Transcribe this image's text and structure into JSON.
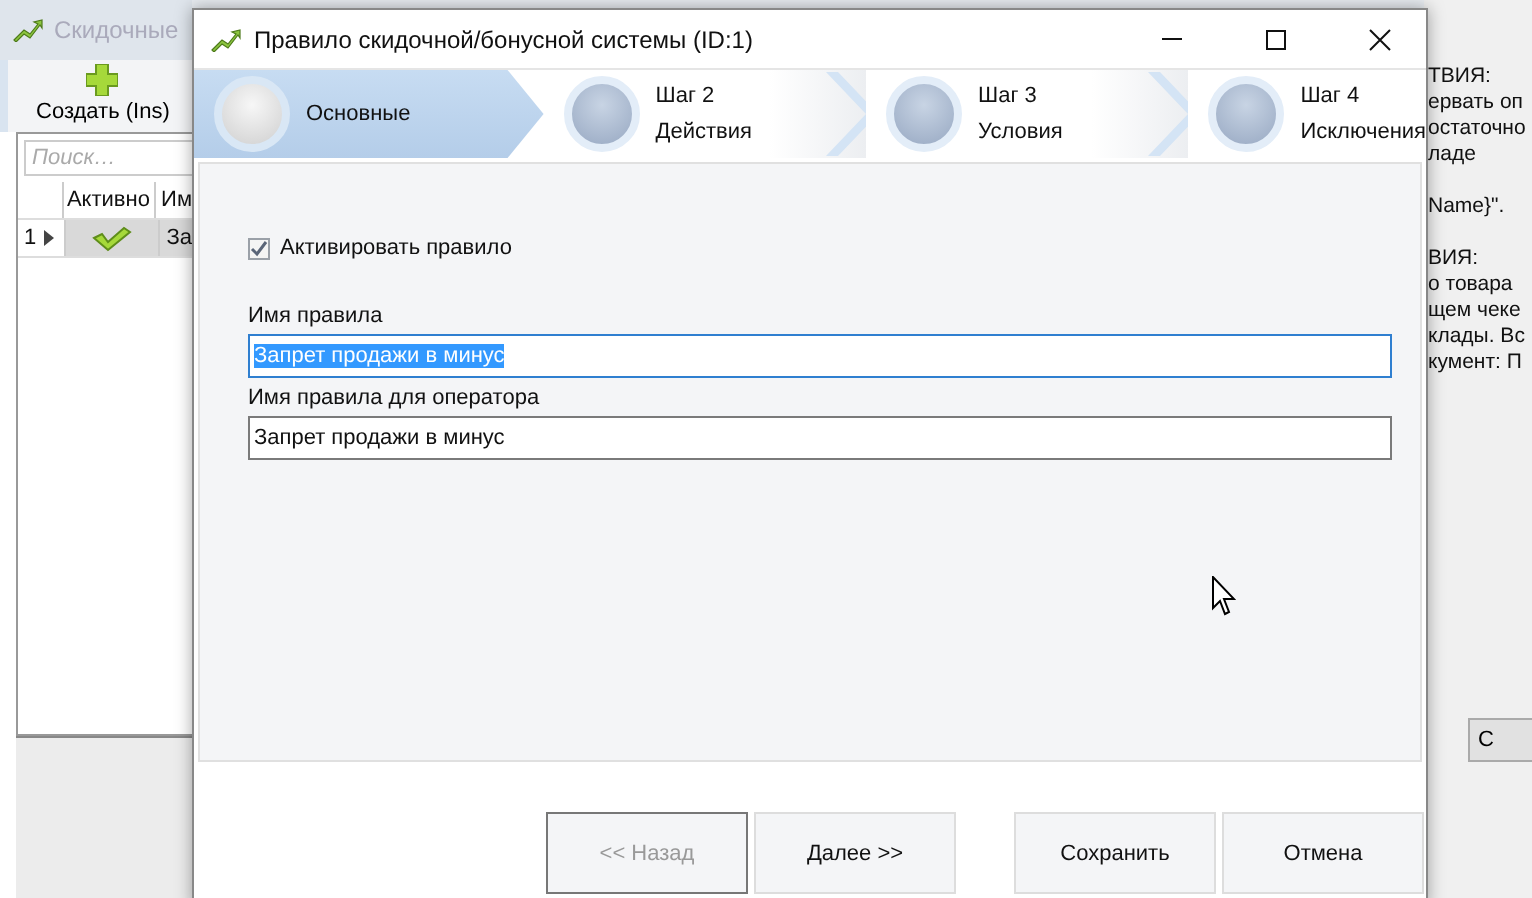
{
  "background_window": {
    "title": "Скидочные",
    "toolbar": {
      "create_button": "Создать (Ins)"
    },
    "search": {
      "placeholder": "Поиск…"
    },
    "table": {
      "columns": [
        "Активно",
        "Им"
      ],
      "rows": [
        {
          "number": "1",
          "selected": true,
          "active": true,
          "name": "За"
        }
      ]
    },
    "details_paragraphs": [
      [
        "ТВИЯ:",
        "ервать оп",
        "остаточно",
        "ладе"
      ],
      [
        "Name}\"."
      ],
      [
        "ВИЯ:",
        "о товара",
        "щем чеке",
        "клады. Вс",
        "кумент: П"
      ]
    ],
    "side_button": "С"
  },
  "dialog": {
    "title": "Правило скидочной/бонусной системы (ID:1)",
    "steps": [
      {
        "name": "Основные",
        "selected": true
      },
      {
        "step_label": "Шаг 2",
        "name": "Действия",
        "selected": false
      },
      {
        "step_label": "Шаг 3",
        "name": "Условия",
        "selected": false
      },
      {
        "step_label": "Шаг 4",
        "name": "Исключения",
        "selected": false
      }
    ],
    "activate_checkbox": {
      "label": "Активировать правило",
      "checked": true
    },
    "fields": [
      {
        "label": "Имя правила",
        "value": "Запрет продажи в минус",
        "focused": true
      },
      {
        "label": "Имя правила для оператора",
        "value": "Запрет продажи в минус",
        "focused": false
      }
    ],
    "buttons": [
      {
        "label": "<< Назад",
        "disabled": true
      },
      {
        "label": "Далее >>",
        "disabled": false
      },
      {
        "label": "Сохранить",
        "disabled": false
      },
      {
        "label": "Отмена",
        "disabled": false
      }
    ]
  }
}
